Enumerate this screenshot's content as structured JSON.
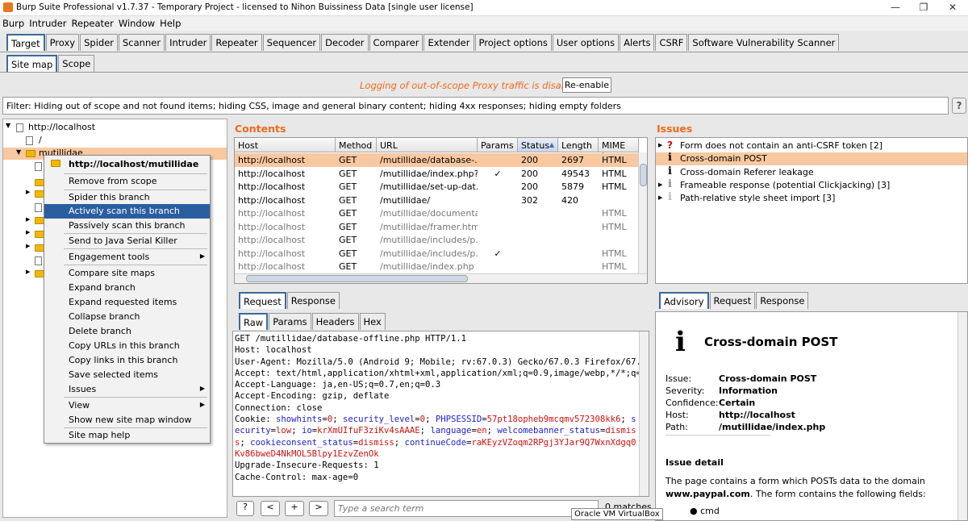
{
  "window": {
    "title": "Burp Suite Professional v1.7.37 - Temporary Project - licensed to Nihon Buissiness Data [single user license]",
    "controls": {
      "minimize": "—",
      "maximize": "❐",
      "close": "✕"
    }
  },
  "menu": [
    "Burp",
    "Intruder",
    "Repeater",
    "Window",
    "Help"
  ],
  "main_tabs": [
    "Target",
    "Proxy",
    "Spider",
    "Scanner",
    "Intruder",
    "Repeater",
    "Sequencer",
    "Decoder",
    "Comparer",
    "Extender",
    "Project options",
    "User options",
    "Alerts",
    "CSRF",
    "Software Vulnerability Scanner"
  ],
  "sub_tabs": [
    "Site map",
    "Scope"
  ],
  "notice": {
    "text": "Logging of out-of-scope Proxy traffic is disabled",
    "button": "Re-enable"
  },
  "filter": {
    "text": "Filter: Hiding out of scope and not found items;  hiding CSS, image and general binary content;  hiding 4xx responses;  hiding empty folders",
    "help": "?"
  },
  "tree": {
    "root": "http://localhost",
    "items": [
      "/",
      "mutillidae"
    ]
  },
  "context_menu": {
    "header": "http://localhost/mutillidae",
    "items": [
      "Remove from scope",
      "Spider this branch",
      "Actively scan this branch",
      "Passively scan this branch",
      "Send to Java Serial Killer",
      "Engagement tools",
      "Compare site maps",
      "Expand branch",
      "Expand requested items",
      "Collapse branch",
      "Delete branch",
      "Copy URLs in this branch",
      "Copy links in this branch",
      "Save selected items",
      "Issues",
      "View",
      "Show new site map window",
      "Site map help"
    ],
    "selected": "Actively scan this branch"
  },
  "contents": {
    "title": "Contents",
    "columns": [
      "Host",
      "Method",
      "URL",
      "Params",
      "Status",
      "Length",
      "MIME typ"
    ],
    "rows": [
      [
        "http://localhost",
        "GET",
        "/mutillidae/database-...",
        "",
        "200",
        "2697",
        "HTML"
      ],
      [
        "http://localhost",
        "GET",
        "/mutillidae/index.php?...",
        "✓",
        "200",
        "49543",
        "HTML"
      ],
      [
        "http://localhost",
        "GET",
        "/mutillidae/set-up-dat...",
        "",
        "200",
        "5879",
        "HTML"
      ],
      [
        "http://localhost",
        "GET",
        "/mutillidae/",
        "",
        "302",
        "420",
        ""
      ],
      [
        "http://localhost",
        "GET",
        "/mutillidae/documenta...",
        "",
        "",
        "",
        "HTML"
      ],
      [
        "http://localhost",
        "GET",
        "/mutillidae/framer.html",
        "",
        "",
        "",
        "HTML"
      ],
      [
        "http://localhost",
        "GET",
        "/mutillidae/includes/p...",
        "",
        "",
        "",
        ""
      ],
      [
        "http://localhost",
        "GET",
        "/mutillidae/includes/p...",
        "✓",
        "",
        "",
        "HTML"
      ],
      [
        "http://localhost",
        "GET",
        "/mutillidae/index.php",
        "",
        "",
        "",
        "HTML"
      ]
    ]
  },
  "issues": {
    "title": "Issues",
    "items": [
      "Form does not contain an anti-CSRF token [2]",
      "Cross-domain POST",
      "Cross-domain Referer leakage",
      "Frameable response (potential Clickjacking) [3]",
      "Path-relative style sheet import [3]"
    ]
  },
  "req_tabs": [
    "Request",
    "Response"
  ],
  "raw_tabs": [
    "Raw",
    "Params",
    "Headers",
    "Hex"
  ],
  "raw_request": {
    "lines": [
      "GET /mutillidae/database-offline.php HTTP/1.1",
      "Host: localhost",
      "User-Agent: Mozilla/5.0 (Android 9; Mobile; rv:67.0.3) Gecko/67.0.3 Firefox/67.0.3",
      "Accept: text/html,application/xhtml+xml,application/xml;q=0.9,image/webp,*/*;q=0.8",
      "Accept-Language: ja,en-US;q=0.7,en;q=0.3",
      "Accept-Encoding: gzip, deflate",
      "Connection: close"
    ],
    "cookie_label": "Cookie: ",
    "cookies": [
      {
        "k": "showhints",
        "v": "0"
      },
      {
        "k": "security_level",
        "v": "0"
      },
      {
        "k": "PHPSESSID",
        "v": "57pt18opheb9mcqmv572308kk6"
      },
      {
        "k": "security",
        "v": "low"
      },
      {
        "k": "io",
        "v": "krXmUIfuF3ziKv4sAAAE"
      },
      {
        "k": "language",
        "v": "en"
      },
      {
        "k": "welcomebanner_status",
        "v": "dismiss"
      },
      {
        "k": "cookieconsent_status",
        "v": "dismiss"
      },
      {
        "k": "continueCode",
        "v": "raKEyzVZoqm2RPgj3YJar9Q7WxnXdgq0Kv86bweD4NkMOL5Blpy1EzvZenOk"
      }
    ],
    "tail": [
      "Upgrade-Insecure-Requests: 1",
      "Cache-Control: max-age=0"
    ]
  },
  "search": {
    "placeholder": "Type a search term",
    "matches": "0 matches",
    "buttons": [
      "?",
      "<",
      "+",
      ">"
    ]
  },
  "tooltip": "Oracle VM VirtualBox",
  "advisory_tabs": [
    "Advisory",
    "Request",
    "Response"
  ],
  "advisory": {
    "title": "Cross-domain POST",
    "fields": [
      {
        "label": "Issue:",
        "value": "Cross-domain POST"
      },
      {
        "label": "Severity:",
        "value": "Information"
      },
      {
        "label": "Confidence:",
        "value": "Certain"
      },
      {
        "label": "Host:",
        "value": "http://localhost"
      },
      {
        "label": "Path:",
        "value": "/mutillidae/index.php"
      }
    ],
    "detail_heading": "Issue detail",
    "detail_pre": "The page contains a form which POSTs data to the domain ",
    "detail_domain": "www.paypal.com",
    "detail_post": ". The form contains the following fields:",
    "bullet": "cmd"
  }
}
